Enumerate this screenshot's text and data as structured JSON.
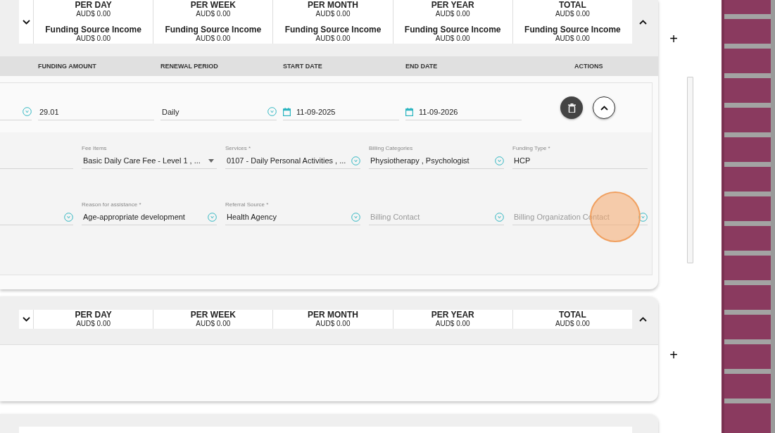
{
  "cards": [
    {
      "summary": [
        {
          "label": "PER DAY",
          "value": "AUD$ 0.00",
          "income_label": "Funding Source Income",
          "income_value": "AUD$ 0.00"
        },
        {
          "label": "PER WEEK",
          "value": "AUD$ 0.00",
          "income_label": "Funding Source Income",
          "income_value": "AUD$ 0.00"
        },
        {
          "label": "PER MONTH",
          "value": "AUD$ 0.00",
          "income_label": "Funding Source Income",
          "income_value": "AUD$ 0.00"
        },
        {
          "label": "PER YEAR",
          "value": "AUD$ 0.00",
          "income_label": "Funding Source Income",
          "income_value": "AUD$ 0.00"
        },
        {
          "label": "TOTAL",
          "value": "AUD$ 0.00",
          "income_label": "Funding Source Income",
          "income_value": "AUD$ 0.00"
        }
      ],
      "columns": [
        "FUNDING AMOUNT",
        "RENEWAL PERIOD",
        "START DATE",
        "END DATE",
        "ACTIONS"
      ],
      "entry": [
        {
          "kind": "select"
        },
        {
          "kind": "text",
          "value": "29.01"
        },
        {
          "kind": "select",
          "value": "Daily"
        },
        {
          "kind": "date",
          "value": "11-09-2025"
        },
        {
          "kind": "date",
          "value": "11-09-2026"
        }
      ],
      "detail_rows": [
        [
          {
            "kind": "text"
          },
          {
            "kind": "caret",
            "label": "Fee Items",
            "value": "Basic Daily Care Fee - Level 1 , ..."
          },
          {
            "kind": "select",
            "label": "Services *",
            "value": "0107 - Daily Personal Activities , ..."
          },
          {
            "kind": "select",
            "label": "Billing Categories",
            "value": "Physiotherapy , Psychologist"
          },
          {
            "kind": "text",
            "label": "Funding Type *",
            "value": "HCP"
          }
        ],
        [
          {
            "kind": "select"
          },
          {
            "kind": "select",
            "label": "Reason for assistance *",
            "value": "Age-appropriate development"
          },
          {
            "kind": "select",
            "label": "Referral Source *",
            "value": "Health Agency"
          },
          {
            "kind": "select",
            "placeholder": "Billing Contact"
          },
          {
            "kind": "select",
            "placeholder": "Billing Organization Contact"
          }
        ]
      ]
    },
    {
      "summary": [
        {
          "label": "PER DAY",
          "value": "AUD$ 0.00"
        },
        {
          "label": "PER WEEK",
          "value": "AUD$ 0.00"
        },
        {
          "label": "PER MONTH",
          "value": "AUD$ 0.00"
        },
        {
          "label": "PER YEAR",
          "value": "AUD$ 0.00"
        },
        {
          "label": "TOTAL",
          "value": "AUD$ 0.00"
        }
      ]
    }
  ],
  "add_buttons": [
    "+",
    "+"
  ]
}
